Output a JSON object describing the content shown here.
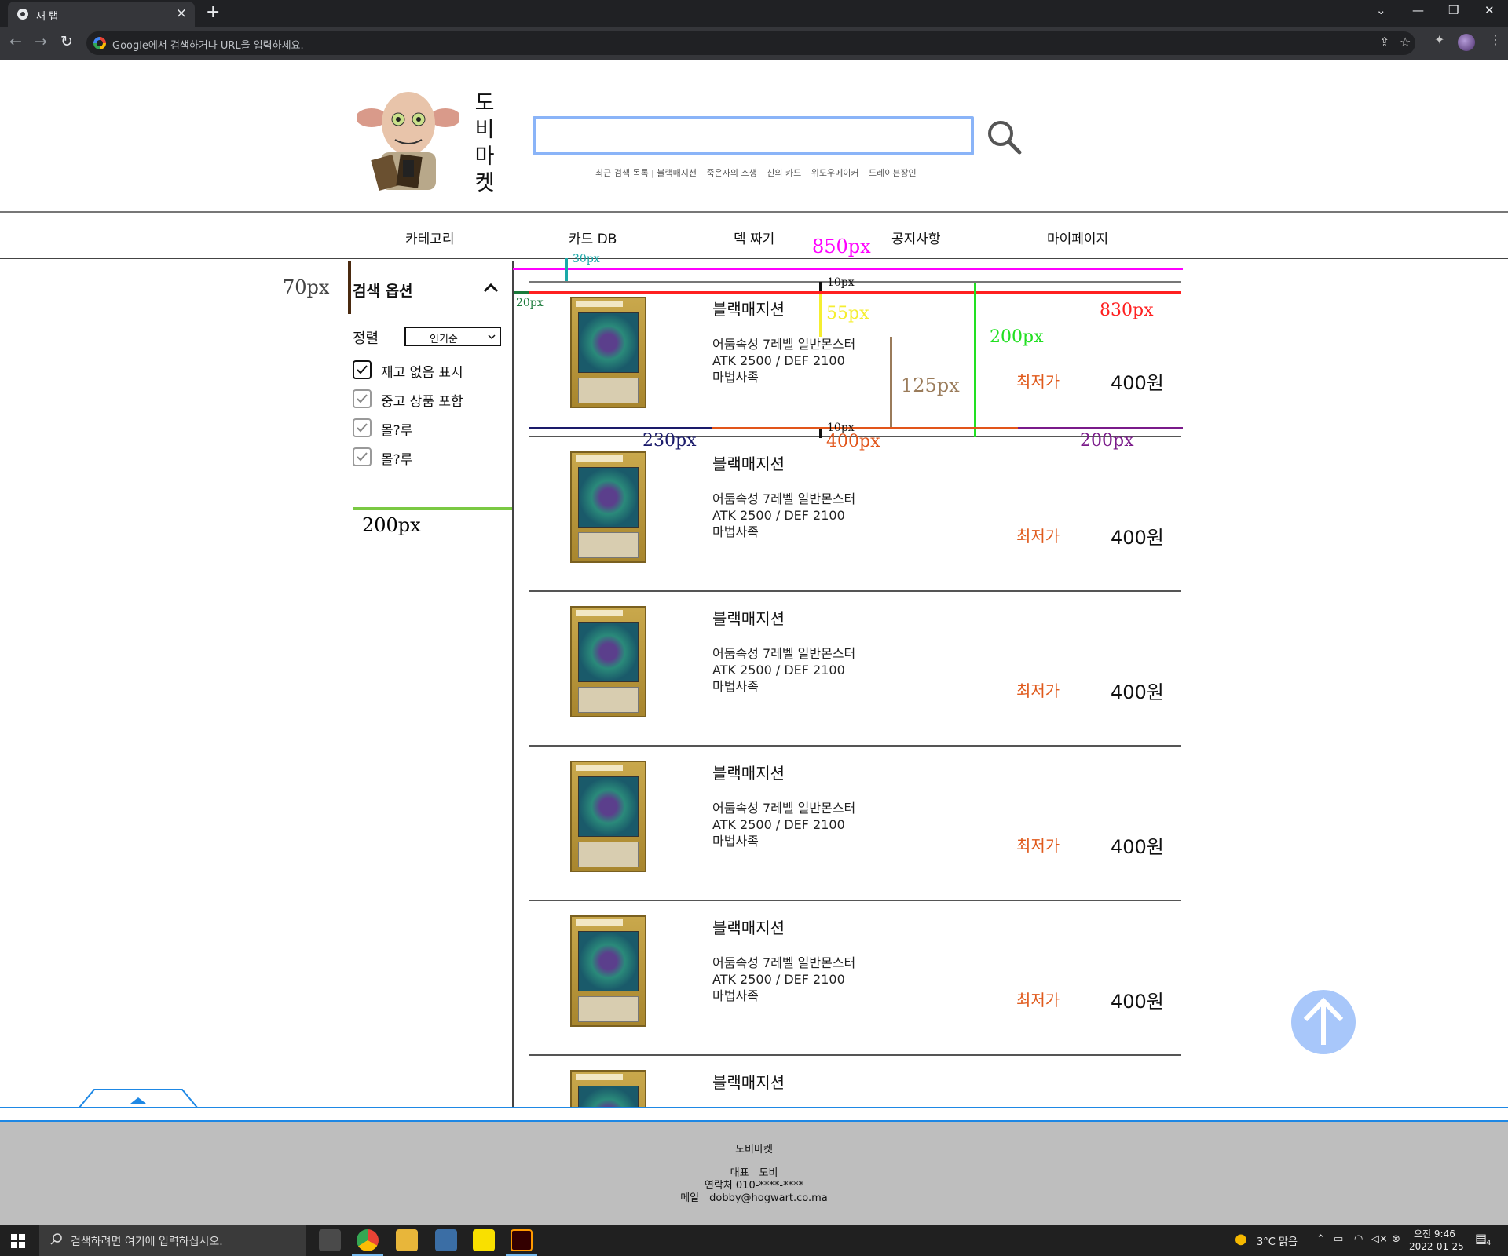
{
  "browser": {
    "tab_title": "새 탭",
    "tab_close": "×",
    "new_tab": "+",
    "omnibox_placeholder": "Google에서 검색하거나 URL을 입력하세요.",
    "win_ctrls": [
      "⌄",
      "—",
      "❐",
      "✕"
    ]
  },
  "header": {
    "logo_text": [
      "도",
      "비",
      "마",
      "켓"
    ],
    "search_value": "",
    "recent_label": "최근 검색 목록 | 블랙매지션",
    "recent_items": [
      "죽은자의 소생",
      "신의 카드",
      "위도우메이커",
      "드레이븐장인"
    ]
  },
  "nav": {
    "items": [
      "카테고리",
      "카드 DB",
      "덱 짜기",
      "공지사항",
      "마이페이지"
    ]
  },
  "sidebar": {
    "title": "검색 옵션",
    "sort_label": "정렬",
    "sort_value": "인기순",
    "options": [
      {
        "label": "재고 없음 표시",
        "checked": true
      },
      {
        "label": "중고 상품 포함",
        "checked": true
      },
      {
        "label": "몰?루",
        "checked": true
      },
      {
        "label": "몰?루",
        "checked": true
      }
    ]
  },
  "products": [
    {
      "name": "블랙매지션",
      "desc": [
        "어둠속성 7레벨 일반몬스터",
        "ATK 2500 / DEF 2100",
        "마법사족"
      ],
      "price_label": "최저가",
      "price": "400원"
    },
    {
      "name": "블랙매지션",
      "desc": [
        "어둠속성 7레벨 일반몬스터",
        "ATK 2500 / DEF 2100",
        "마법사족"
      ],
      "price_label": "최저가",
      "price": "400원"
    },
    {
      "name": "블랙매지션",
      "desc": [
        "어둠속성 7레벨 일반몬스터",
        "ATK 2500 / DEF 2100",
        "마법사족"
      ],
      "price_label": "최저가",
      "price": "400원"
    },
    {
      "name": "블랙매지션",
      "desc": [
        "어둠속성 7레벨 일반몬스터",
        "ATK 2500 / DEF 2100",
        "마법사족"
      ],
      "price_label": "최저가",
      "price": "400원"
    },
    {
      "name": "블랙매지션",
      "desc": [
        "어둠속성 7레벨 일반몬스터",
        "ATK 2500 / DEF 2100",
        "마법사족"
      ],
      "price_label": "최저가",
      "price": "400원"
    },
    {
      "name": "블랙매지션",
      "desc": [],
      "price_label": "",
      "price": ""
    }
  ],
  "annotations": {
    "a70": "70px",
    "a30": "30px",
    "a850": "850px",
    "a20": "20px",
    "a10a": "10px",
    "a55": "55px",
    "a830": "830px",
    "a200g": "200px",
    "a125": "125px",
    "a230": "230px",
    "a10b": "10px",
    "a400": "400px",
    "a200p": "200px",
    "a200side": "200px",
    "colors": {
      "magenta": "#ff00ff",
      "red": "#ff2020",
      "teal": "#1aa8a8",
      "green": "#1a7a3a",
      "yellow": "#f5ee30",
      "lime": "#22e022",
      "tan": "#9a7b5a",
      "navy": "#1a1a6a",
      "orange": "#e2551a",
      "purple": "#7a1a8a",
      "sidegreen": "#2ac02a"
    }
  },
  "footer": {
    "brand": "도비마켓",
    "rep": "대표　도비",
    "contact": "연락처  010-****-****",
    "email": "메일　dobby@hogwart.co.ma"
  },
  "taskbar": {
    "search_placeholder": "검색하려면 여기에 입력하십시오.",
    "weather": "3°C  맑음",
    "time": "오전 9:46",
    "date": "2022-01-25",
    "notification_count": "4"
  }
}
